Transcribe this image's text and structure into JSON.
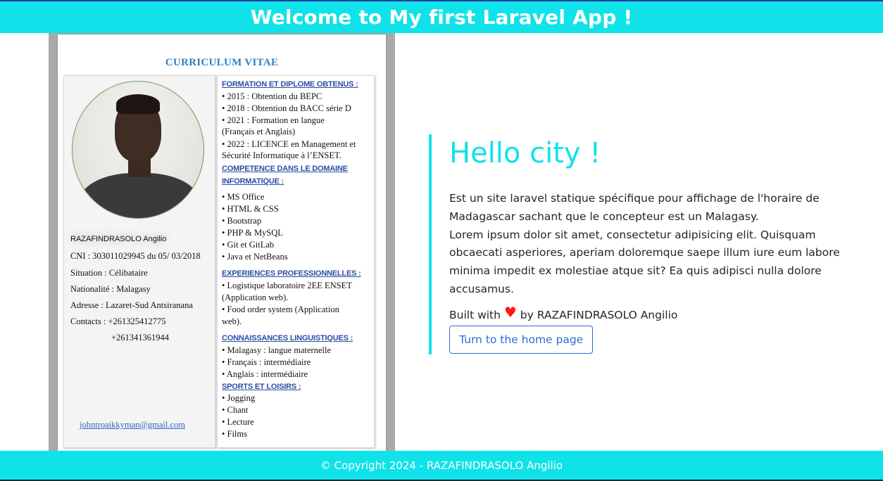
{
  "header": {
    "title": "Welcome to My first Laravel App !"
  },
  "cv": {
    "title": "CURRICULUM VITAE",
    "name": "RAZAFINDRASOLO Angilio",
    "cni": "CNI : 303011029945 du 05/ 03/2018",
    "situation": "Situation : Célibataire",
    "nationality": "Nationalité : Malagasy",
    "address": "Adresse : Lazaret-Sud Antsiranana",
    "contacts": "Contacts : +261325412775",
    "contacts2": "+261341361944",
    "email": "johntroaikkyman@gmail.com",
    "sections": {
      "formation": "FORMATION ET DIPLOME OBTENUS :",
      "competence": "COMPETENCE DANS LE DOMAINE",
      "competence2": "INFORMATIQUE :",
      "experiences": "EXPERIENCES PROFESSIONNELLES :",
      "langues": "CONNAISSANCES LINGUISTIQUES :",
      "sports": "SPORTS ET LOISIRS :"
    },
    "formation_lines": [
      "• 2015 : Obtention du BEPC",
      "• 2018 : Obtention du BACC série D",
      "• 2021 : Formation en langue",
      "(Français et Anglais)",
      "• 2022 : LICENCE en Management et",
      "Sécurité Informatique à l’ENSET."
    ],
    "competence_lines": [
      "• MS Office",
      "• HTML & CSS",
      "• Bootstrap",
      "• PHP & MySQL",
      "• Git et GitLab",
      "• Java et NetBeans"
    ],
    "experience_lines": [
      "• Logistique laboratoire 2EE ENSET",
      "(Application web).",
      "• Food order system (Application",
      "web)."
    ],
    "langue_lines": [
      "• Malagasy : langue maternelle",
      "• Français : intermédiaire",
      "• Anglais : intermédiaire"
    ],
    "sport_lines": [
      "• Jogging",
      "• Chant",
      "• Lecture",
      "• Films"
    ]
  },
  "hello": {
    "heading": "Hello city !",
    "paragraph_line1": "Est un site laravel statique spécifique pour affichage de l'horaire de Madagascar sachant que le concepteur est un Malagasy.",
    "paragraph_line2": "Lorem ipsum dolor sit amet, consectetur adipisicing elit. Quisquam obcaecati asperiores, aperiam doloremque saepe illum iure eum labore minima impedit ex molestiae atque sit? Ea quis adipisci nulla dolore accusamus.",
    "built_prefix": "Built with",
    "built_suffix": "by RAZAFINDRASOLO Angilio",
    "heart_icon": "heart-icon",
    "heart_color": "#ff1a1a",
    "button_label": "Turn to the home page"
  },
  "footer": {
    "text": "© Copyright 2024 - RAZAFINDRASOLO Angilio"
  },
  "colors": {
    "accent": "#10e2e9",
    "link": "#2f6ad6"
  }
}
